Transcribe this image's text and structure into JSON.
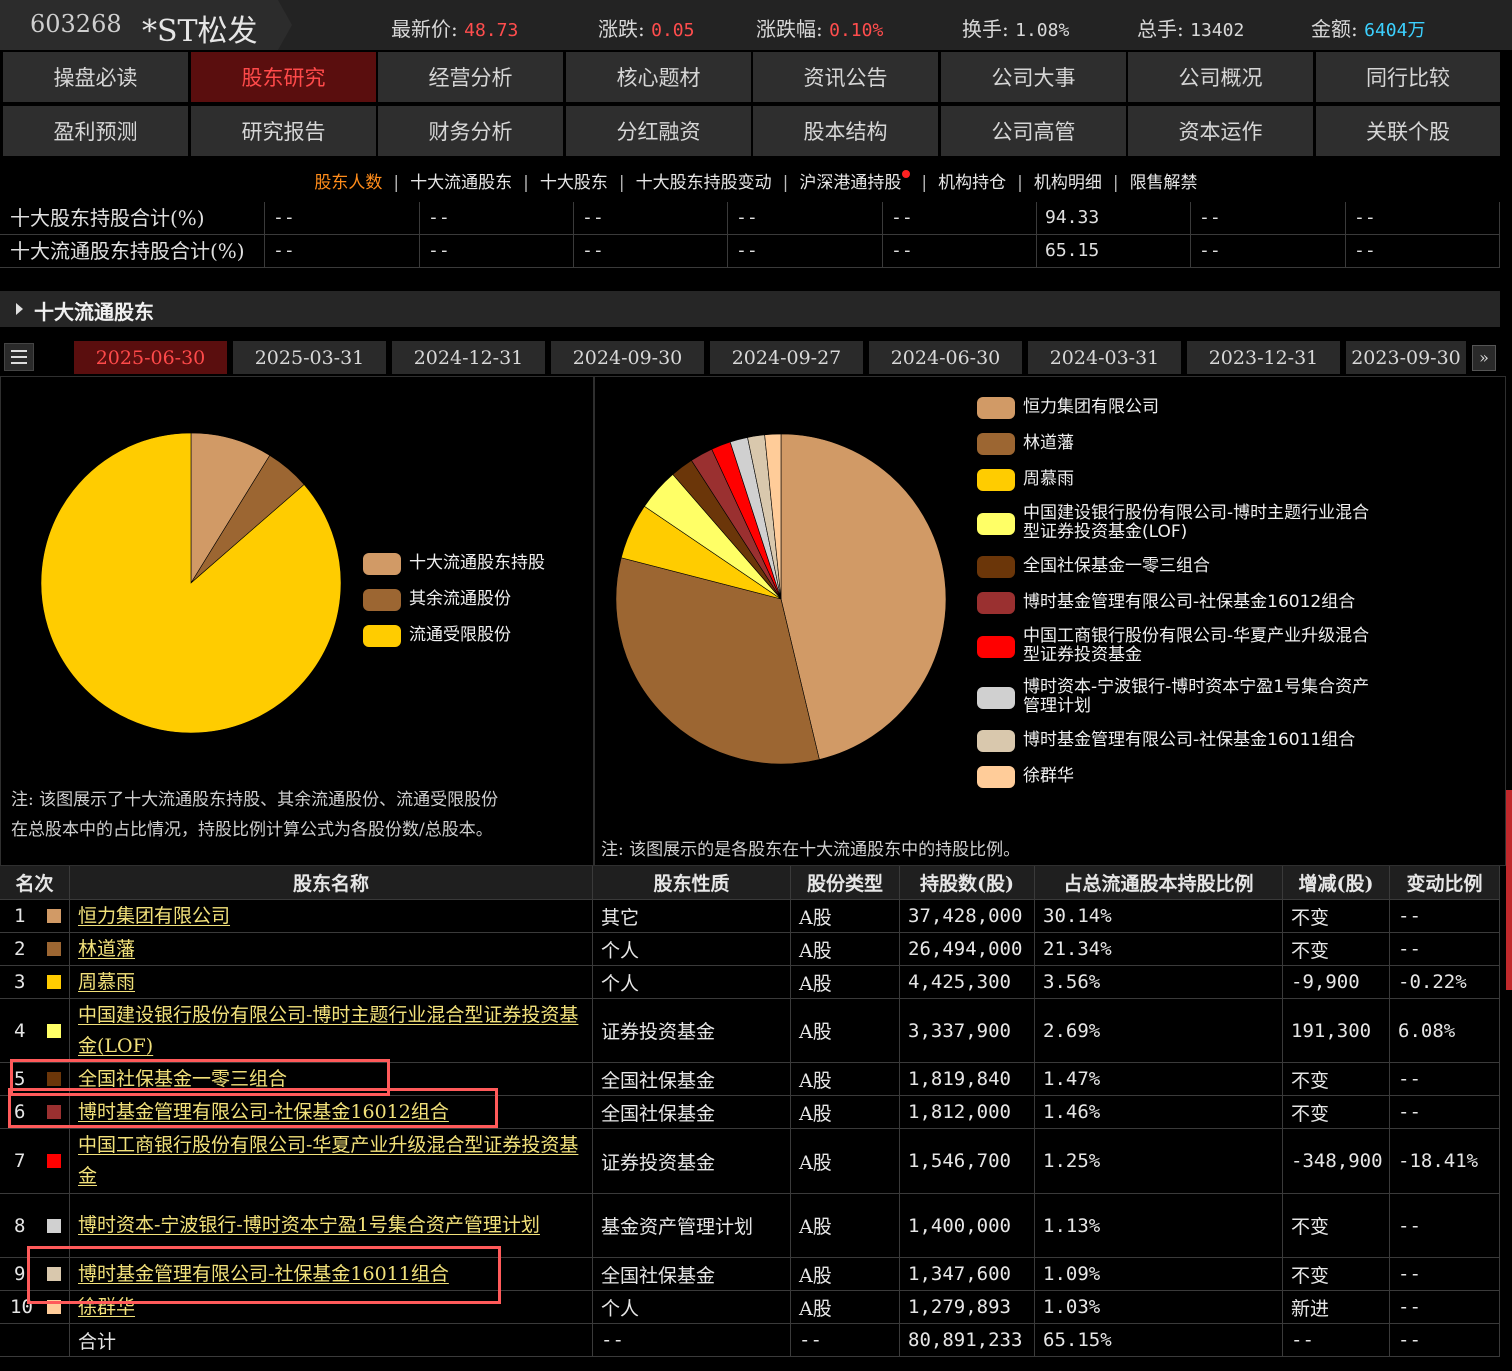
{
  "header": {
    "code": "603268",
    "name": "*ST松发",
    "stats": [
      {
        "label": "最新价: ",
        "value": "48.73",
        "color": "red"
      },
      {
        "label": "涨跌: ",
        "value": "0.05",
        "color": "red"
      },
      {
        "label": "涨跌幅: ",
        "value": "0.10%",
        "color": "red"
      },
      {
        "label": "换手: ",
        "value": "1.08%",
        "color": "plain"
      },
      {
        "label": "总手: ",
        "value": "13402",
        "color": "plain"
      },
      {
        "label": "金额: ",
        "value": "6404万",
        "color": "cyan"
      }
    ]
  },
  "nav": {
    "row1": [
      "操盘必读",
      "股东研究",
      "经营分析",
      "核心题材",
      "资讯公告",
      "公司大事",
      "公司概况",
      "同行比较"
    ],
    "row2": [
      "盈利预测",
      "研究报告",
      "财务分析",
      "分红融资",
      "股本结构",
      "公司高管",
      "资本运作",
      "关联个股"
    ],
    "active": "股东研究"
  },
  "subnav": {
    "items": [
      "股东人数",
      "十大流通股东",
      "十大股东",
      "十大股东持股变动",
      "沪深港通持股",
      "机构持仓",
      "机构明细",
      "限售解禁"
    ],
    "active": "股东人数",
    "dot_item": "沪深港通持股"
  },
  "summary": {
    "rows": [
      {
        "label": "十大股东持股合计(%)",
        "cells": [
          "--",
          "--",
          "--",
          "--",
          "--",
          "94.33",
          "--",
          "--"
        ]
      },
      {
        "label": "十大流通股东持股合计(%)",
        "cells": [
          "--",
          "--",
          "--",
          "--",
          "--",
          "65.15",
          "--",
          "--"
        ]
      }
    ]
  },
  "section": {
    "title": "十大流通股东"
  },
  "date_tabs": {
    "items": [
      "2025-06-30",
      "2025-03-31",
      "2024-12-31",
      "2024-09-30",
      "2024-09-27",
      "2024-06-30",
      "2024-03-31",
      "2023-12-31",
      "2023-09-30"
    ],
    "active": 0
  },
  "chart_data": [
    {
      "type": "pie",
      "series": [
        {
          "name": "十大流通股东持股",
          "value": 8.8,
          "color": "#d19a66"
        },
        {
          "name": "其余流通股份",
          "value": 4.8,
          "color": "#9c6632"
        },
        {
          "name": "流通受限股份",
          "value": 86.4,
          "color": "#ffcc00"
        }
      ]
    },
    {
      "type": "pie",
      "series": [
        {
          "name": "恒力集团有限公司",
          "value": 46.27,
          "color": "#d19a66"
        },
        {
          "name": "林道藩",
          "value": 32.75,
          "color": "#9c6632"
        },
        {
          "name": "周慕雨",
          "value": 5.47,
          "color": "#ffcc00"
        },
        {
          "name": "中国建设银行股份有限公司-博时主题行业混合型证券投资基金(LOF)",
          "value": 4.13,
          "color": "#ffff66"
        },
        {
          "name": "全国社保基金一零三组合",
          "value": 2.25,
          "color": "#6b3609"
        },
        {
          "name": "博时基金管理有限公司-社保基金16012组合",
          "value": 2.24,
          "color": "#9a3030"
        },
        {
          "name": "中国工商银行股份有限公司-华夏产业升级混合型证券投资基金",
          "value": 1.91,
          "color": "#ff0000"
        },
        {
          "name": "博时资本-宁波银行-博时资本宁盈1号集合资产管理计划",
          "value": 1.73,
          "color": "#d0d0d0"
        },
        {
          "name": "博时基金管理有限公司-社保基金16011组合",
          "value": 1.67,
          "color": "#d9c8ad"
        },
        {
          "name": "徐群华",
          "value": 1.58,
          "color": "#ffcc99"
        }
      ]
    }
  ],
  "legend_left": [
    "十大流通股东持股",
    "其余流通股份",
    "流通受限股份"
  ],
  "legend_right": [
    [
      "恒力集团有限公司"
    ],
    [
      "林道藩"
    ],
    [
      "周慕雨"
    ],
    [
      "中国建设银行股份有限公司-博时主题行业混合",
      "型证券投资基金(LOF)"
    ],
    [
      "全国社保基金一零三组合"
    ],
    [
      "博时基金管理有限公司-社保基金16012组合"
    ],
    [
      "中国工商银行股份有限公司-华夏产业升级混合",
      "型证券投资基金"
    ],
    [
      "博时资本-宁波银行-博时资本宁盈1号集合资产",
      "管理计划"
    ],
    [
      "博时基金管理有限公司-社保基金16011组合"
    ],
    [
      "徐群华"
    ]
  ],
  "notes": {
    "left": [
      "注: 该图展示了十大流通股东持股、其余流通股份、流通受限股份",
      "在总股本中的占比情况，持股比例计算公式为各股份数/总股本。"
    ],
    "right": "注: 该图展示的是各股东在十大流通股东中的持股比例。"
  },
  "table": {
    "headers": [
      "名次",
      "股东名称",
      "股东性质",
      "股份类型",
      "持股数(股)",
      "占总流通股本持股比例",
      "增减(股)",
      "变动比例"
    ],
    "rows": [
      {
        "rank": "1",
        "color": "#d19a66",
        "name": "恒力集团有限公司",
        "nature": "其它",
        "type": "A股",
        "shares": "37,428,000",
        "ratio": "30.14%",
        "change": "不变",
        "change_color": "plain",
        "pct": "--",
        "pct_color": "plain"
      },
      {
        "rank": "2",
        "color": "#9c6632",
        "name": "林道藩",
        "nature": "个人",
        "type": "A股",
        "shares": "26,494,000",
        "ratio": "21.34%",
        "change": "不变",
        "change_color": "plain",
        "pct": "--",
        "pct_color": "plain"
      },
      {
        "rank": "3",
        "color": "#ffcc00",
        "name": "周慕雨",
        "nature": "个人",
        "type": "A股",
        "shares": "4,425,300",
        "ratio": "3.56%",
        "change": "-9,900",
        "change_color": "grn",
        "pct": "-0.22%",
        "pct_color": "grn"
      },
      {
        "rank": "4",
        "color": "#ffff66",
        "name": "中国建设银行股份有限公司-博时主题行业混合型证券投资基金(LOF)",
        "nature": "证券投资基金",
        "type": "A股",
        "shares": "3,337,900",
        "ratio": "2.69%",
        "change": "191,300",
        "change_color": "red",
        "pct": "6.08%",
        "pct_color": "red"
      },
      {
        "rank": "5",
        "color": "#6b3609",
        "name": "全国社保基金一零三组合",
        "nature": "全国社保基金",
        "type": "A股",
        "shares": "1,819,840",
        "ratio": "1.47%",
        "change": "不变",
        "change_color": "plain",
        "pct": "--",
        "pct_color": "plain"
      },
      {
        "rank": "6",
        "color": "#9a3030",
        "name": "博时基金管理有限公司-社保基金16012组合",
        "nature": "全国社保基金",
        "type": "A股",
        "shares": "1,812,000",
        "ratio": "1.46%",
        "change": "不变",
        "change_color": "plain",
        "pct": "--",
        "pct_color": "plain"
      },
      {
        "rank": "7",
        "color": "#ff0000",
        "name": "中国工商银行股份有限公司-华夏产业升级混合型证券投资基金",
        "nature": "证券投资基金",
        "type": "A股",
        "shares": "1,546,700",
        "ratio": "1.25%",
        "change": "-348,900",
        "change_color": "grn",
        "pct": "-18.41%",
        "pct_color": "grn"
      },
      {
        "rank": "8",
        "color": "#d0d0d0",
        "name": "博时资本-宁波银行-博时资本宁盈1号集合资产管理计划",
        "nature": "基金资产管理计划",
        "type": "A股",
        "shares": "1,400,000",
        "ratio": "1.13%",
        "change": "不变",
        "change_color": "plain",
        "pct": "--",
        "pct_color": "plain"
      },
      {
        "rank": "9",
        "color": "#d9c8ad",
        "name": "博时基金管理有限公司-社保基金16011组合",
        "nature": "全国社保基金",
        "type": "A股",
        "shares": "1,347,600",
        "ratio": "1.09%",
        "change": "不变",
        "change_color": "plain",
        "pct": "--",
        "pct_color": "plain"
      },
      {
        "rank": "10",
        "color": "#ffcc99",
        "name": "徐群华",
        "nature": "个人",
        "type": "A股",
        "shares": "1,279,893",
        "ratio": "1.03%",
        "change": "新进",
        "change_color": "red",
        "pct": "--",
        "pct_color": "red"
      }
    ],
    "total": {
      "label": "合计",
      "nature": "--",
      "type": "--",
      "shares": "80,891,233",
      "ratio": "65.15%",
      "change": "--",
      "pct": "--"
    }
  }
}
